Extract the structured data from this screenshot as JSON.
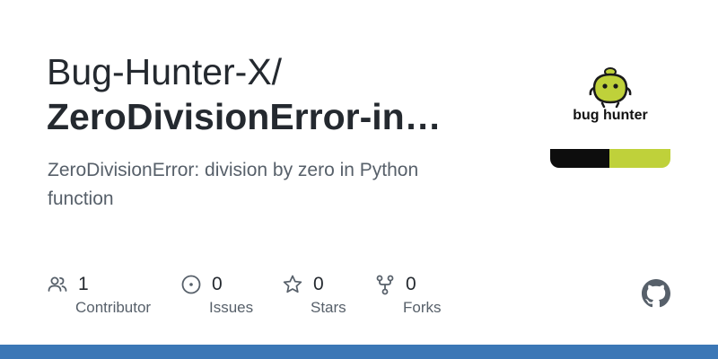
{
  "repo_card": {
    "owner": "Bug-Hunter-X/",
    "name": "ZeroDivisionError-in-…",
    "description": "ZeroDivisionError: division by zero in Python function"
  },
  "logo": {
    "text": "bug hunter",
    "colors": {
      "black": "#0d0d0d",
      "green": "#bfd13a"
    }
  },
  "stats": [
    {
      "icon": "people-icon",
      "count": "1",
      "label": "Contributor"
    },
    {
      "icon": "issue-icon",
      "count": "0",
      "label": "Issues"
    },
    {
      "icon": "star-icon",
      "count": "0",
      "label": "Stars"
    },
    {
      "icon": "fork-icon",
      "count": "0",
      "label": "Forks"
    }
  ],
  "footer": {
    "icon": "github-icon",
    "bar_color": "#3b77b6"
  }
}
